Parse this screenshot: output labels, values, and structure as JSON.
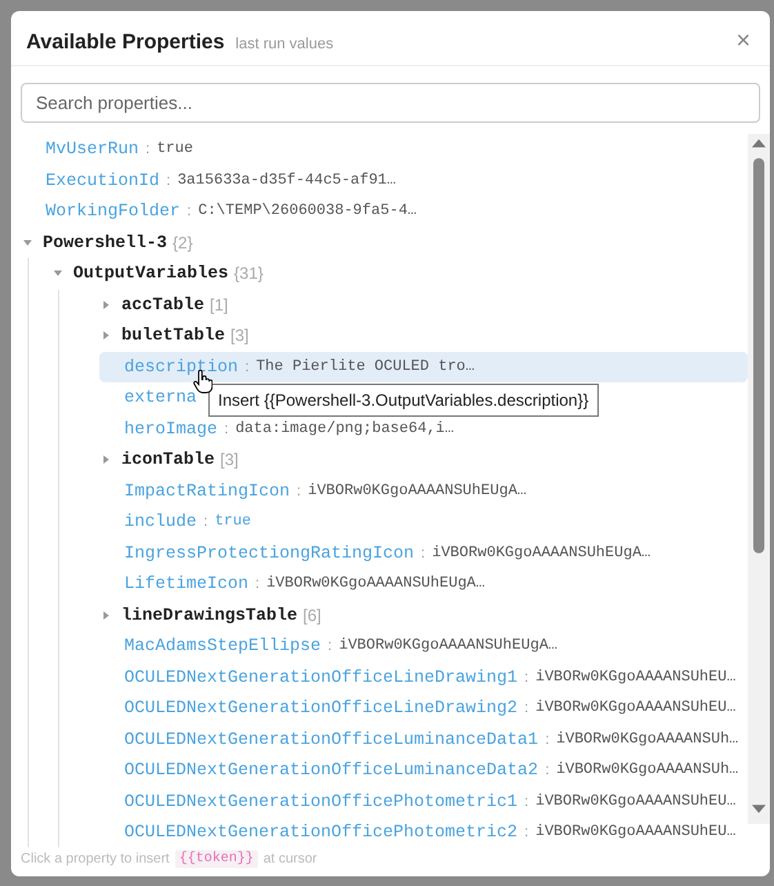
{
  "dialog": {
    "title": "Available Properties",
    "subtitle": "last run values",
    "close": "×"
  },
  "search": {
    "placeholder": "Search properties..."
  },
  "tree": [
    {
      "kind": "leaf",
      "name": "MvUserRun",
      "separator": ":",
      "value": "true",
      "selected": false
    },
    {
      "kind": "leaf",
      "name": "ExecutionId",
      "separator": ":",
      "value": "3a15633a-d35f-44c5-af91…",
      "selected": false
    },
    {
      "kind": "leaf",
      "name": "WorkingFolder",
      "separator": ":",
      "value": "C:\\TEMP\\26060038-9fa5-4…",
      "selected": false
    },
    {
      "kind": "group",
      "name": "Powershell-3",
      "count": "{2}",
      "expanded": true,
      "children": [
        {
          "kind": "group",
          "name": "OutputVariables",
          "count": "{31}",
          "expanded": true,
          "children": [
            {
              "kind": "group",
              "name": "accTable",
              "count": "[1]",
              "expanded": false
            },
            {
              "kind": "group",
              "name": "buletTable",
              "count": "[3]",
              "expanded": false
            },
            {
              "kind": "leaf",
              "name": "description",
              "separator": ":",
              "value": "The Pierlite OCULED tro…",
              "selected": true,
              "tooltip": "Insert {{Powershell-3.OutputVariables.description}}"
            },
            {
              "kind": "leaf",
              "name": "externa",
              "selected": false
            },
            {
              "kind": "leaf",
              "name": "heroImage",
              "separator": ":",
              "value": "data:image/png;base64,i…",
              "selected": false
            },
            {
              "kind": "group",
              "name": "iconTable",
              "count": "[3]",
              "expanded": false
            },
            {
              "kind": "leaf",
              "name": "ImpactRatingIcon",
              "separator": ":",
              "value": "iVBORw0KGgoAAAANSUhEUgA…",
              "selected": false
            },
            {
              "kind": "boolean",
              "name": "include",
              "separator": ":",
              "value": "true",
              "selected": false
            },
            {
              "kind": "leaf",
              "name": "IngressProtectiongRatingIcon",
              "separator": ":",
              "value": "iVBORw0KGgoAAAANSUhEUgA…",
              "selected": false
            },
            {
              "kind": "leaf",
              "name": "LifetimeIcon",
              "separator": ":",
              "value": "iVBORw0KGgoAAAANSUhEUgA…",
              "selected": false
            },
            {
              "kind": "group",
              "name": "lineDrawingsTable",
              "count": "[6]",
              "expanded": false
            },
            {
              "kind": "leaf",
              "name": "MacAdamsStepEllipse",
              "separator": ":",
              "value": "iVBORw0KGgoAAAANSUhEUgA…",
              "selected": false
            },
            {
              "kind": "leaf",
              "name": "OCULEDNextGenerationOfficeLineDrawing1",
              "separator": ":",
              "value": "iVBORw0KGgoAAAANSUhEU…",
              "selected": false
            },
            {
              "kind": "leaf",
              "name": "OCULEDNextGenerationOfficeLineDrawing2",
              "separator": ":",
              "value": "iVBORw0KGgoAAAANSUhEU…",
              "selected": false
            },
            {
              "kind": "leaf",
              "name": "OCULEDNextGenerationOfficeLuminanceData1",
              "separator": ":",
              "value": "iVBORw0KGgoAAAANSUh…",
              "selected": false
            },
            {
              "kind": "leaf",
              "name": "OCULEDNextGenerationOfficeLuminanceData2",
              "separator": ":",
              "value": "iVBORw0KGgoAAAANSUh…",
              "selected": false
            },
            {
              "kind": "leaf",
              "name": "OCULEDNextGenerationOfficePhotometric1",
              "separator": ":",
              "value": "iVBORw0KGgoAAAANSUhEU…",
              "selected": false
            },
            {
              "kind": "leaf",
              "name": "OCULEDNextGenerationOfficePhotometric2",
              "separator": ":",
              "value": "iVBORw0KGgoAAAANSUhEU…",
              "selected": false
            }
          ]
        }
      ]
    }
  ],
  "footer": {
    "before": "Click a property to insert",
    "token": "{{token}}",
    "after": "at cursor"
  }
}
